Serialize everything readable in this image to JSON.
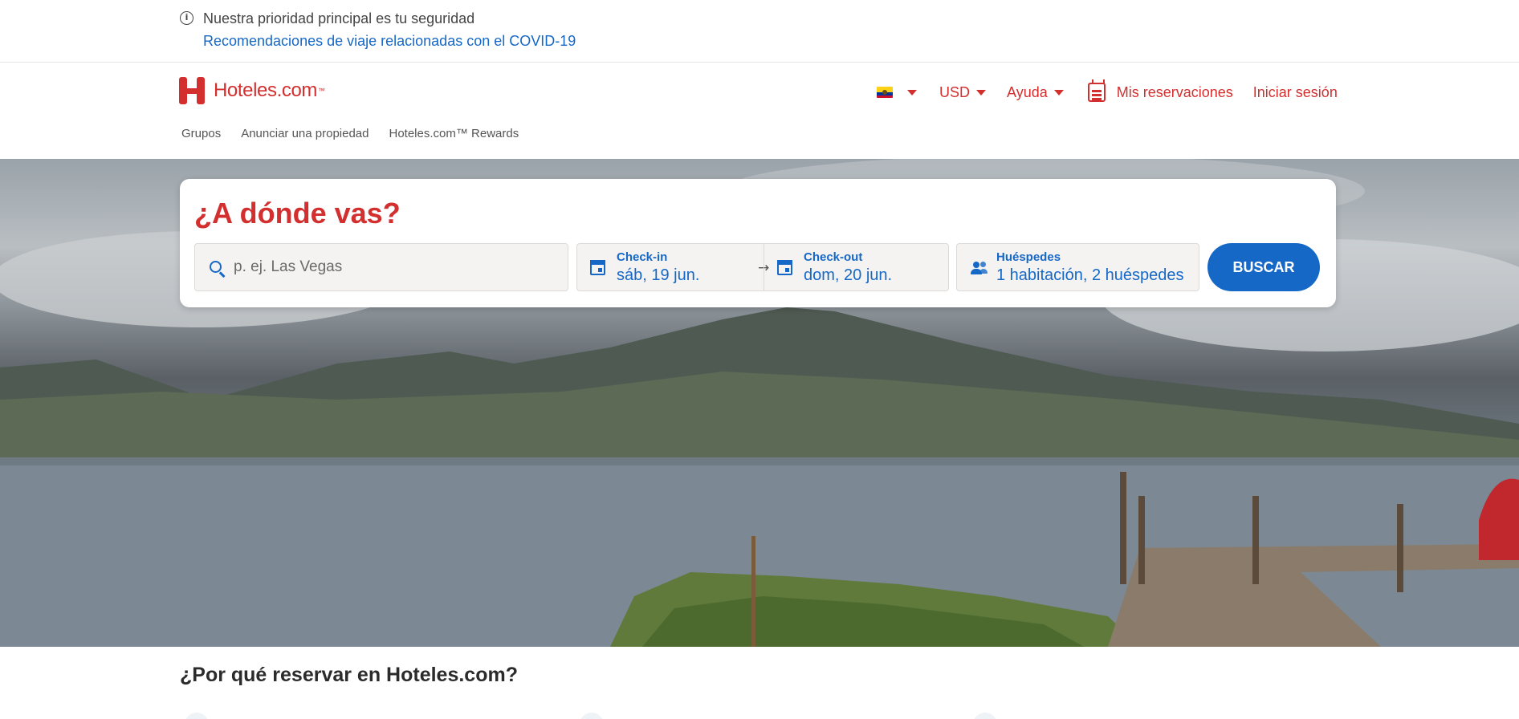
{
  "covid_banner": {
    "icon": "info-icon",
    "title": "Nuestra prioridad principal es tu seguridad",
    "link": "Recomendaciones de viaje relacionadas con el COVID-19"
  },
  "header": {
    "logo_text": "Hoteles.com",
    "logo_tm": "™",
    "flag_icon": "ecuador-flag-icon",
    "currency": "USD",
    "help": "Ayuda",
    "reservations": "Mis reservaciones",
    "sign_in": "Iniciar sesión",
    "subnav": [
      "Grupos",
      "Anunciar una propiedad",
      "Hoteles.com™ Rewards"
    ]
  },
  "search": {
    "title": "¿A dónde vas?",
    "destination_placeholder": "p. ej. Las Vegas",
    "destination_value": "",
    "checkin_label": "Check-in",
    "checkin_value": "sáb, 19 jun.",
    "checkout_label": "Check-out",
    "checkout_value": "dom, 20 jun.",
    "guests_label": "Huéspedes",
    "guests_value": "1 habitación, 2 huéspedes",
    "button": "BUSCAR"
  },
  "why": {
    "title": "¿Por qué reservar en Hoteles.com?"
  },
  "colors": {
    "brand_red": "#d32f2f",
    "action_blue": "#1668c7"
  }
}
